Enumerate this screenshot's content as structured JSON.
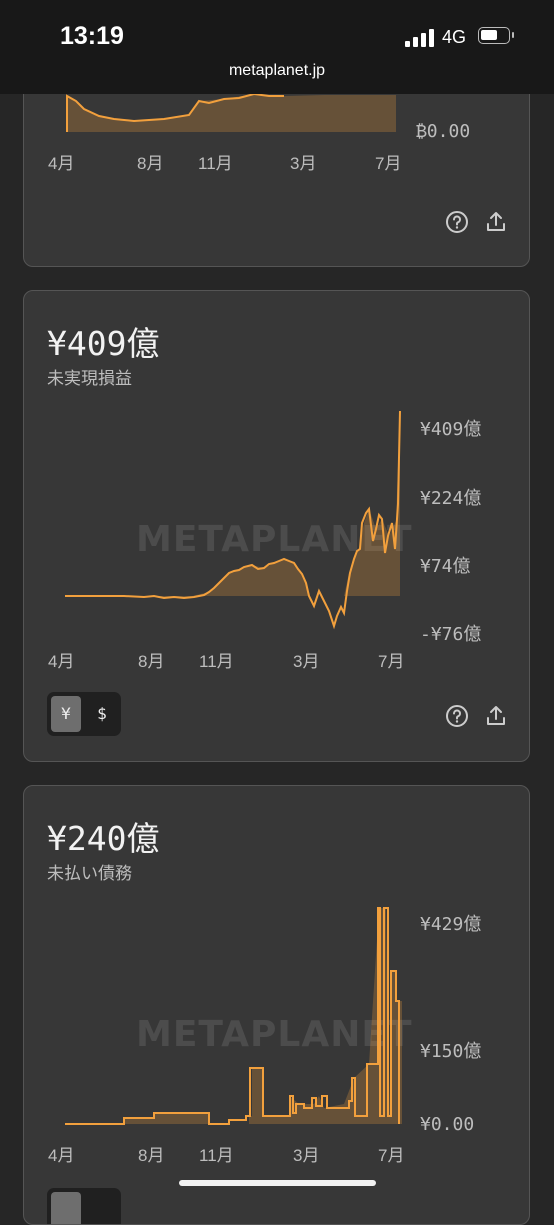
{
  "status_bar": {
    "time": "13:19",
    "network": "4G",
    "battery_level": 0.55
  },
  "browser": {
    "url": "metaplanet.jp"
  },
  "cards": [
    {
      "id": "bitcoin-holdings-card",
      "y_label": "₿0.00",
      "x_labels": [
        "4月",
        "8月",
        "11月",
        "3月",
        "7月"
      ],
      "icons": [
        "help-icon",
        "share-icon"
      ]
    },
    {
      "id": "unrealized-pnl-card",
      "value": "¥409億",
      "subtitle": "未実現損益",
      "watermark": "METAPLANET",
      "y_labels": [
        "¥409億",
        "¥224億",
        "¥74億",
        "-¥76億"
      ],
      "x_labels": [
        "4月",
        "8月",
        "11月",
        "3月",
        "7月"
      ],
      "currency_toggle": {
        "options": [
          "¥",
          "$"
        ],
        "selected": "¥"
      },
      "icons": [
        "help-icon",
        "share-icon"
      ]
    },
    {
      "id": "outstanding-debt-card",
      "value": "¥240億",
      "subtitle": "未払い債務",
      "watermark": "METAPLANET",
      "y_labels": [
        "¥429億",
        "¥150億",
        "¥0.00"
      ],
      "x_labels": [
        "4月",
        "8月",
        "11月",
        "3月",
        "7月"
      ]
    }
  ],
  "colors": {
    "accent": "#f2a03d",
    "card_bg": "#373737",
    "page_bg": "#262626"
  }
}
